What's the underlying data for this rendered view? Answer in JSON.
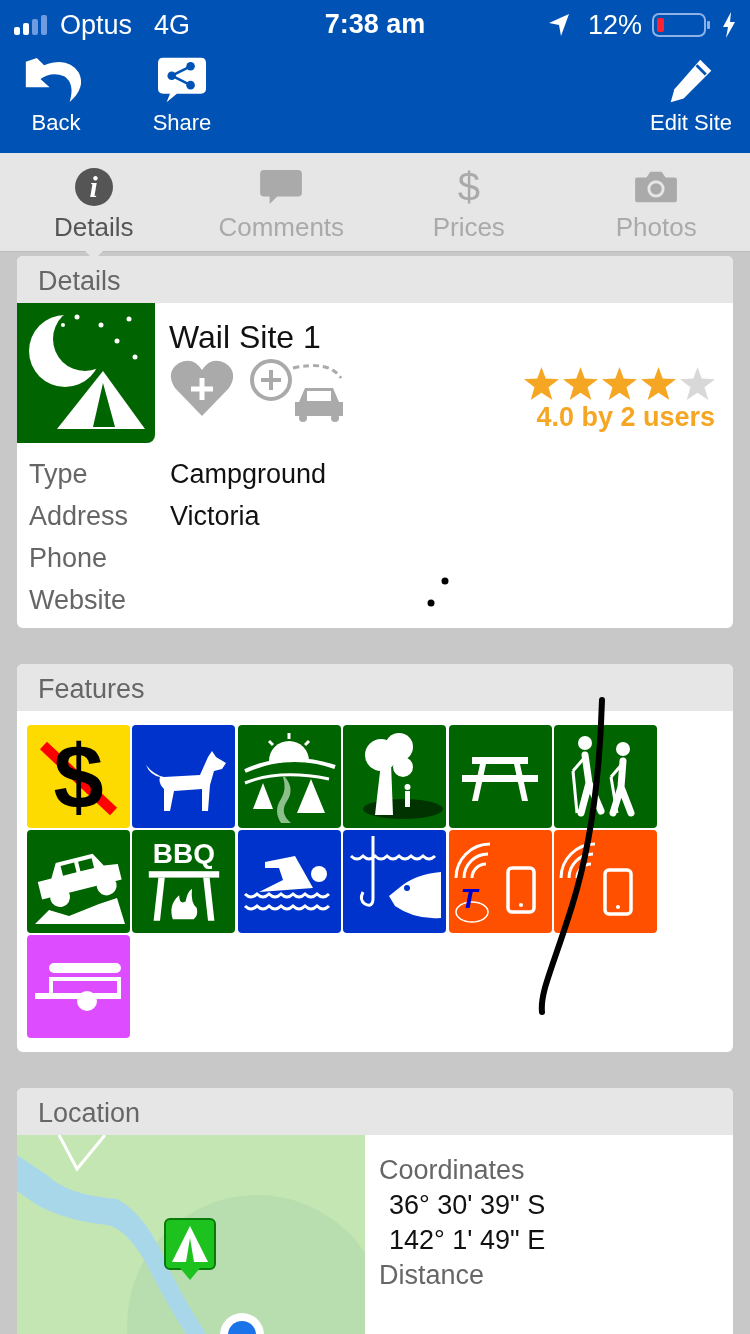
{
  "status_bar": {
    "carrier": "Optus",
    "network": "4G",
    "time": "7:38 am",
    "battery": "12%"
  },
  "toolbar": {
    "buttons": [
      {
        "kind": "back",
        "label": "Back"
      },
      {
        "kind": "share",
        "label": "Share"
      },
      {
        "kind": "edit",
        "label": "Edit Site"
      }
    ]
  },
  "tabs": [
    {
      "kind": "info",
      "symbol": "i",
      "label": "Details",
      "selected": true
    },
    {
      "kind": "comments",
      "label": "Comments",
      "selected": false
    },
    {
      "kind": "prices",
      "symbol": "$",
      "label": "Prices",
      "selected": false
    },
    {
      "kind": "photos",
      "label": "Photos",
      "selected": false
    }
  ],
  "details": {
    "header": "Details",
    "name": "Wail Site 1",
    "stars": 4,
    "rating": "4.0 by 2 users",
    "fields": [
      {
        "label": "Type",
        "value": "Campground"
      },
      {
        "label": "Address",
        "value": "Victoria"
      },
      {
        "label": "Phone"
      },
      {
        "label": "Website"
      }
    ]
  },
  "features": {
    "header": "Features",
    "items": [
      {
        "kind": "no-fee",
        "color": "#fedb00",
        "text": "$"
      },
      {
        "kind": "dogs",
        "color": "#0033cc"
      },
      {
        "kind": "scenery",
        "color": "#006400"
      },
      {
        "kind": "shade",
        "color": "#006400"
      },
      {
        "kind": "picnic-table",
        "color": "#006400"
      },
      {
        "kind": "hiking",
        "color": "#006400"
      },
      {
        "kind": "four-wheel-drive",
        "color": "#006400"
      },
      {
        "kind": "bbq",
        "color": "#006400",
        "text": "BBQ"
      },
      {
        "kind": "swimming",
        "color": "#0033cc"
      },
      {
        "kind": "fishing",
        "color": "#0033cc"
      },
      {
        "kind": "carrier-coverage",
        "color": "#ff5000",
        "text": "T"
      },
      {
        "kind": "mobile-coverage",
        "color": "#ff5000"
      },
      {
        "kind": "trailer",
        "color": "#dd4cff"
      }
    ]
  },
  "location": {
    "header": "Location",
    "map": {
      "kind": "picture"
    },
    "coordinates_label": "Coordinates",
    "coordinates": [
      "36° 30' 39\" S",
      "142° 1' 49\" E"
    ],
    "distance_label": "Distance"
  }
}
